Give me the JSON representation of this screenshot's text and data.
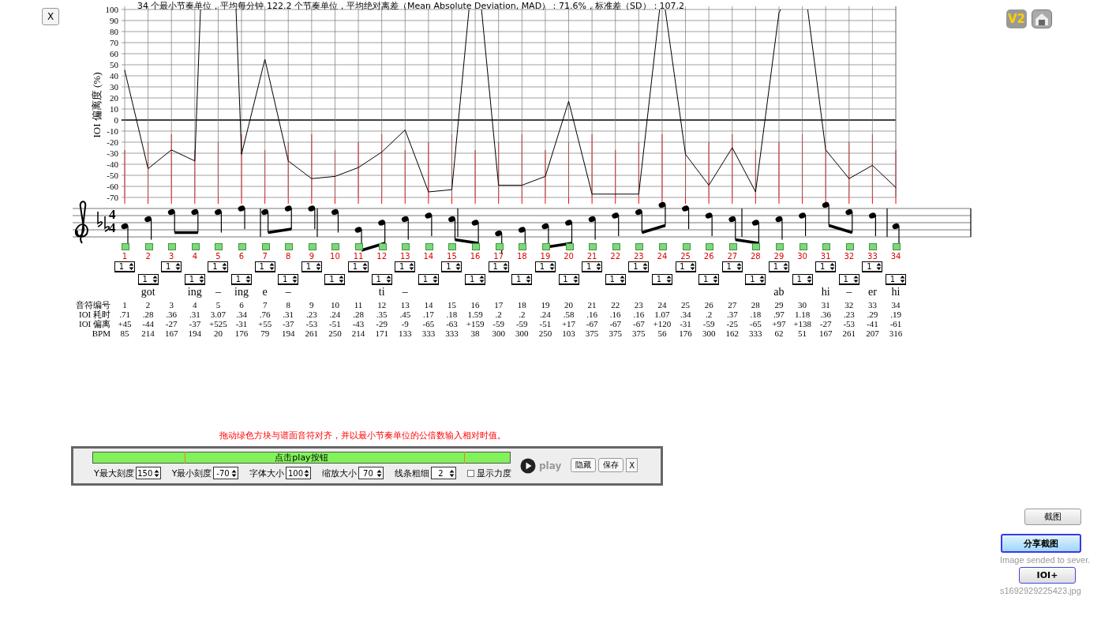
{
  "close_button": "X",
  "top_icons": {
    "version": "V2"
  },
  "chart": {
    "caption": "34 个最小节奏单位，平均每分钟 122.2 个节奏单位，平均绝对离差（Mean Absolute Deviation, MAD）：71.6%，标准差（SD）：107.2",
    "chart_data": {
      "type": "line",
      "ylabel": "IOI 偏离度 (%)",
      "grid": true,
      "x": [
        1,
        2,
        3,
        4,
        5,
        6,
        7,
        8,
        9,
        10,
        11,
        12,
        13,
        14,
        15,
        16,
        17,
        18,
        19,
        20,
        21,
        22,
        23,
        24,
        25,
        26,
        27,
        28,
        29,
        30,
        31,
        32,
        33,
        34
      ],
      "ylim": [
        -70,
        100
      ],
      "yticks": [
        100,
        90,
        80,
        70,
        60,
        50,
        40,
        30,
        20,
        10,
        0,
        -10,
        -20,
        -30,
        -40,
        -50,
        -60,
        -70
      ],
      "series": [
        {
          "color": "#000000",
          "values": [
            45,
            -44,
            -27,
            -37,
            null,
            -31,
            55,
            -37,
            -53,
            -51,
            -43,
            -29,
            -9,
            -65,
            -63,
            null,
            -59,
            -59,
            -51,
            17,
            -67,
            -67,
            -67,
            null,
            -31,
            -59,
            -25,
            -65,
            97,
            null,
            -27,
            -53,
            -41,
            -61
          ]
        }
      ]
    }
  },
  "score": {
    "time_signature": [
      "4",
      "4"
    ]
  },
  "table": {
    "row_labels": [
      "音符编号",
      "IOI 耗时",
      "IOI 偏离",
      "BPM"
    ],
    "notes": [
      {
        "beats": "1",
        "no": "1",
        "ioi": ".71",
        "dev": "+45",
        "bpm": "85"
      },
      {
        "beats": "1",
        "no": "2",
        "ioi": ".28",
        "dev": "-44",
        "bpm": "214",
        "lyric": "got"
      },
      {
        "beats": "1",
        "no": "3",
        "ioi": ".36",
        "dev": "-27",
        "bpm": "167"
      },
      {
        "beats": "1",
        "no": "4",
        "ioi": ".31",
        "dev": "-37",
        "bpm": "194",
        "lyric": "ing"
      },
      {
        "beats": "1",
        "no": "5",
        "ioi": "3.07",
        "dev": "+525",
        "bpm": "20",
        "lyric": "–"
      },
      {
        "beats": "1",
        "no": "6",
        "ioi": ".34",
        "dev": "-31",
        "bpm": "176",
        "lyric": "ing"
      },
      {
        "beats": "1",
        "no": "7",
        "ioi": ".76",
        "dev": "+55",
        "bpm": "79",
        "lyric": "e"
      },
      {
        "beats": "1",
        "no": "8",
        "ioi": ".31",
        "dev": "-37",
        "bpm": "194",
        "lyric": "–"
      },
      {
        "beats": "1",
        "no": "9",
        "ioi": ".23",
        "dev": "-53",
        "bpm": "261"
      },
      {
        "beats": "1",
        "no": "10",
        "ioi": ".24",
        "dev": "-51",
        "bpm": "250"
      },
      {
        "beats": "1",
        "no": "11",
        "ioi": ".28",
        "dev": "-43",
        "bpm": "214"
      },
      {
        "beats": "1",
        "no": "12",
        "ioi": ".35",
        "dev": "-29",
        "bpm": "171",
        "lyric": "ti"
      },
      {
        "beats": "1",
        "no": "13",
        "ioi": ".45",
        "dev": "-9",
        "bpm": "133",
        "lyric": "–"
      },
      {
        "beats": "1",
        "no": "14",
        "ioi": ".17",
        "dev": "-65",
        "bpm": "333"
      },
      {
        "beats": "1",
        "no": "15",
        "ioi": ".18",
        "dev": "-63",
        "bpm": "333"
      },
      {
        "beats": "1",
        "no": "16",
        "ioi": "1.59",
        "dev": "+159",
        "bpm": "38"
      },
      {
        "beats": "1",
        "no": "17",
        "ioi": ".2",
        "dev": "-59",
        "bpm": "300"
      },
      {
        "beats": "1",
        "no": "18",
        "ioi": ".2",
        "dev": "-59",
        "bpm": "300"
      },
      {
        "beats": "1",
        "no": "19",
        "ioi": ".24",
        "dev": "-51",
        "bpm": "250"
      },
      {
        "beats": "1",
        "no": "20",
        "ioi": ".58",
        "dev": "+17",
        "bpm": "103"
      },
      {
        "beats": "1",
        "no": "21",
        "ioi": ".16",
        "dev": "-67",
        "bpm": "375"
      },
      {
        "beats": "1",
        "no": "22",
        "ioi": ".16",
        "dev": "-67",
        "bpm": "375"
      },
      {
        "beats": "1",
        "no": "23",
        "ioi": ".16",
        "dev": "-67",
        "bpm": "375"
      },
      {
        "beats": "1",
        "no": "24",
        "ioi": "1.07",
        "dev": "+120",
        "bpm": "56"
      },
      {
        "beats": "1",
        "no": "25",
        "ioi": ".34",
        "dev": "-31",
        "bpm": "176"
      },
      {
        "beats": "1",
        "no": "26",
        "ioi": ".2",
        "dev": "-59",
        "bpm": "300"
      },
      {
        "beats": "1",
        "no": "27",
        "ioi": ".37",
        "dev": "-25",
        "bpm": "162"
      },
      {
        "beats": "1",
        "no": "28",
        "ioi": ".18",
        "dev": "-65",
        "bpm": "333"
      },
      {
        "beats": "1",
        "no": "29",
        "ioi": ".97",
        "dev": "+97",
        "bpm": "62",
        "lyric": "ab"
      },
      {
        "beats": "1",
        "no": "30",
        "ioi": "1.18",
        "dev": "+138",
        "bpm": "51"
      },
      {
        "beats": "1",
        "no": "31",
        "ioi": ".36",
        "dev": "-27",
        "bpm": "167",
        "lyric": "hi"
      },
      {
        "beats": "1",
        "no": "32",
        "ioi": ".23",
        "dev": "-53",
        "bpm": "261",
        "lyric": "–"
      },
      {
        "beats": "1",
        "no": "33",
        "ioi": ".29",
        "dev": "-41",
        "bpm": "207",
        "lyric": "er"
      },
      {
        "beats": "1",
        "no": "34",
        "ioi": ".19",
        "dev": "-61",
        "bpm": "316",
        "lyric": "hi"
      }
    ]
  },
  "hint": "拖动绿色方块与谱面音符对齐，并以最小节奏单位的公倍数输入相对时值。",
  "panel": {
    "progress_label": "点击play按钮",
    "settings": [
      {
        "label": "Y最大刻度",
        "value": "150"
      },
      {
        "label": "Y最小刻度",
        "value": "-70"
      },
      {
        "label": "字体大小",
        "value": "100"
      },
      {
        "label": "缩放大小",
        "value": "70"
      },
      {
        "label": "线条粗细",
        "value": "2"
      }
    ],
    "show_force": {
      "label": "显示力度",
      "checked": false
    },
    "play": {
      "label": "play",
      "disabled": true
    },
    "buttons": [
      "隐藏",
      "保存",
      "X"
    ]
  },
  "side": {
    "screenshot_button": "截图",
    "share_button": "分享截图",
    "status": "Image sended to sever.",
    "ioi_button": "IOI+",
    "filename": "s1692929225423.jpg"
  }
}
